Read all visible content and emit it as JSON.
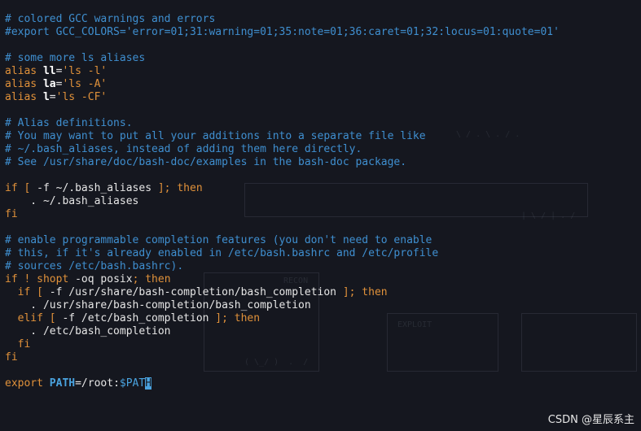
{
  "terminal": {
    "lines": [
      [
        {
          "t": "# colored GCC warnings and errors",
          "k": "c"
        }
      ],
      [
        {
          "t": "#export GCC_COLORS='error=01;31:warning=01;35:note=01;36:caret=01;32:locus=01:quote=01'",
          "k": "c"
        }
      ],
      [],
      [
        {
          "t": "# some more ls aliases",
          "k": "c"
        }
      ],
      [
        {
          "t": "alias ",
          "k": "cm"
        },
        {
          "t": "ll",
          "k": "b"
        },
        {
          "t": "=",
          "k": "w"
        },
        {
          "t": "'ls -l'",
          "k": "s"
        }
      ],
      [
        {
          "t": "alias ",
          "k": "cm"
        },
        {
          "t": "la",
          "k": "b"
        },
        {
          "t": "=",
          "k": "w"
        },
        {
          "t": "'ls -A'",
          "k": "s"
        }
      ],
      [
        {
          "t": "alias ",
          "k": "cm"
        },
        {
          "t": "l",
          "k": "b"
        },
        {
          "t": "=",
          "k": "w"
        },
        {
          "t": "'ls -CF'",
          "k": "s"
        }
      ],
      [],
      [
        {
          "t": "# Alias definitions.",
          "k": "c"
        }
      ],
      [
        {
          "t": "# You may want to put all your additions into a separate file like",
          "k": "c"
        }
      ],
      [
        {
          "t": "# ~/.bash_aliases, instead of adding them here directly.",
          "k": "c"
        }
      ],
      [
        {
          "t": "# See /usr/share/doc/bash-doc/examples in the bash-doc package.",
          "k": "c"
        }
      ],
      [],
      [
        {
          "t": "if ",
          "k": "kw"
        },
        {
          "t": "[ ",
          "k": "s"
        },
        {
          "t": "-f ~/.bash_aliases ",
          "k": "w"
        },
        {
          "t": "]; then",
          "k": "kw"
        }
      ],
      [
        {
          "t": "    . ~/.bash_aliases",
          "k": "w"
        }
      ],
      [
        {
          "t": "fi",
          "k": "kw"
        }
      ],
      [],
      [
        {
          "t": "# enable programmable completion features (you don't need to enable",
          "k": "c"
        }
      ],
      [
        {
          "t": "# this, if it's already enabled in /etc/bash.bashrc and /etc/profile",
          "k": "c"
        }
      ],
      [
        {
          "t": "# sources /etc/bash.bashrc).",
          "k": "c"
        }
      ],
      [
        {
          "t": "if ! ",
          "k": "kw"
        },
        {
          "t": "shopt",
          "k": "s"
        },
        {
          "t": " -oq posix",
          "k": "w"
        },
        {
          "t": "; then",
          "k": "kw"
        }
      ],
      [
        {
          "t": "  if ",
          "k": "kw"
        },
        {
          "t": "[ ",
          "k": "s"
        },
        {
          "t": "-f /usr/share/bash-completion/bash_completion ",
          "k": "w"
        },
        {
          "t": "]; then",
          "k": "kw"
        }
      ],
      [
        {
          "t": "    . /usr/share/bash-completion/bash_completion",
          "k": "w"
        }
      ],
      [
        {
          "t": "  elif ",
          "k": "kw"
        },
        {
          "t": "[ ",
          "k": "s"
        },
        {
          "t": "-f /etc/bash_completion ",
          "k": "w"
        },
        {
          "t": "]; then",
          "k": "kw"
        }
      ],
      [
        {
          "t": "    . /etc/bash_completion",
          "k": "w"
        }
      ],
      [
        {
          "t": "  fi",
          "k": "kw"
        }
      ],
      [
        {
          "t": "fi",
          "k": "kw"
        }
      ],
      [],
      [
        {
          "t": "export ",
          "k": "cm"
        },
        {
          "t": "PATH",
          "k": "vn"
        },
        {
          "t": "=/root:",
          "k": "w"
        },
        {
          "t": "$PAT",
          "k": "v"
        },
        {
          "t": "H",
          "k": "cursor"
        }
      ]
    ]
  },
  "watermark": "CSDN @星辰系主",
  "colors": {
    "background": "#15171f",
    "comment": "#3f8fd0",
    "keyword": "#e0913a",
    "text": "#e6e6e6",
    "variable": "#4aa3df"
  }
}
